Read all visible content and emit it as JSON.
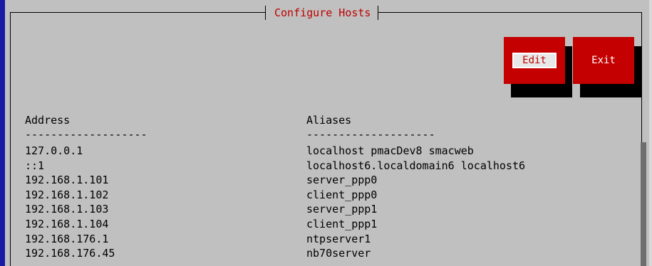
{
  "dialog": {
    "title": "Configure Hosts"
  },
  "buttons": {
    "edit_label": "Edit",
    "exit_label": "Exit"
  },
  "columns": {
    "address_header": "Address",
    "aliases_header": "Aliases",
    "address_rule": "-------------------",
    "aliases_rule": "--------------------"
  },
  "hosts": [
    {
      "address": "127.0.0.1",
      "aliases": "localhost pmacDev8 smacweb"
    },
    {
      "address": "::1",
      "aliases": "localhost6.localdomain6 localhost6"
    },
    {
      "address": "192.168.1.101",
      "aliases": "server_ppp0"
    },
    {
      "address": "192.168.1.102",
      "aliases": "client_ppp0"
    },
    {
      "address": "192.168.1.103",
      "aliases": "server_ppp1"
    },
    {
      "address": "192.168.1.104",
      "aliases": "client_ppp1"
    },
    {
      "address": "192.168.176.1",
      "aliases": "ntpserver1"
    },
    {
      "address": "192.168.176.45",
      "aliases": "nb70server"
    }
  ],
  "colors": {
    "background": "#c0c0c0",
    "accent_red": "#c40000",
    "title_red": "#c00000",
    "left_bar_blue": "#1a1aa6"
  }
}
